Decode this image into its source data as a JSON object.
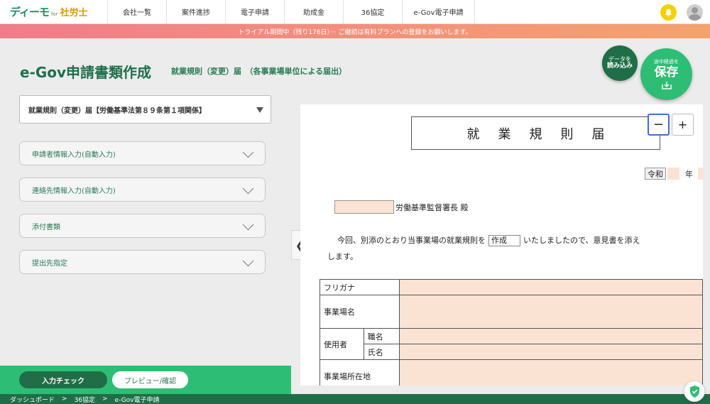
{
  "brand": {
    "logo": "ディーモ",
    "for": "for",
    "sub": "社労士"
  },
  "nav": [
    "会社一覧",
    "案件進捗",
    "電子申請",
    "助成金",
    "36協定",
    "e-Gov電子申請"
  ],
  "trial_banner": "トライアル期間中（残り176日）··· ご継続は有料プランへの登録をお願いします。",
  "page": {
    "title": "e-Gov申請書類作成",
    "subtitle": "就業規則（変更）届　（各事業場単位による届出）"
  },
  "actions": {
    "load_line1": "データを",
    "load_line2": "読み込み",
    "save_line1": "途中経過を",
    "save_line2": "保存"
  },
  "form_select": "就業規則（変更）届【労働基準法第８９条第１項関係】",
  "accordion": [
    "申請者情報入力(自動入力)",
    "連絡先情報入力(自動入力)",
    "添付書類",
    "提出先指定"
  ],
  "bottom": {
    "check": "入力チェック",
    "preview": "プレビュー/確認"
  },
  "breadcrumb": [
    "ダッシュボード",
    ">",
    "36協定",
    ">",
    "e-Gov電子申請"
  ],
  "handle": "❮",
  "doc": {
    "title": "就業規則届",
    "zoom_minus": "−",
    "zoom_plus": "+",
    "era": "令和",
    "year_label": "年",
    "office_suffix": "労働基準監督署長 殿",
    "paragraph_pre": "今回、別添のとおり当事業場の就業規則を",
    "paragraph_field": "作成",
    "paragraph_post": "いたしましたので、意見書を添え",
    "paragraph_line2": "します。",
    "table": {
      "furigana": "フリガナ",
      "office_name": "事業場名",
      "employer": "使用者",
      "job_title": "職名",
      "name": "氏名",
      "office_address": "事業場所在地"
    }
  },
  "colors": {
    "brand_green": "#1f6e48",
    "accent_green": "#2ebd74",
    "field_fill": "#fbe3d3",
    "bell": "#f5d000"
  }
}
